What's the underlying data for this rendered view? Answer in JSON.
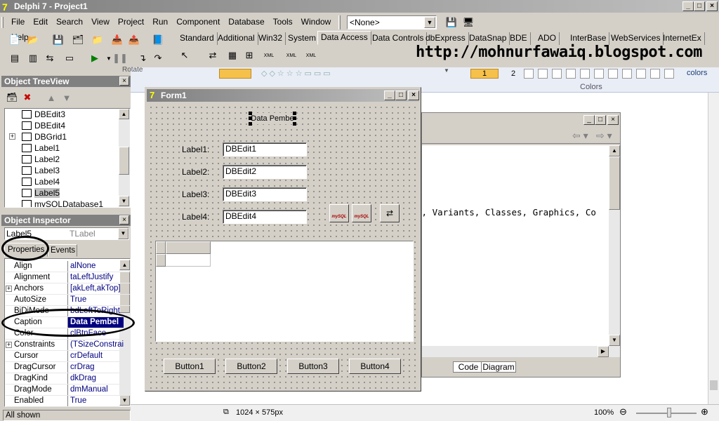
{
  "window": {
    "title": "Delphi 7 - Project1"
  },
  "menu": [
    "File",
    "Edit",
    "Search",
    "View",
    "Project",
    "Run",
    "Component",
    "Database",
    "Tools",
    "Window",
    "Help"
  ],
  "desktop_combo": {
    "value": "<None>"
  },
  "palette": {
    "tabs": [
      "Standard",
      "Additional",
      "Win32",
      "System",
      "Data Access",
      "Data Controls",
      "dbExpress",
      "DataSnap",
      "BDE",
      "ADO",
      "InterBase",
      "WebServices",
      "InternetEx"
    ],
    "active_tab": "Data Access"
  },
  "watermark": "http://mohnurfawaiq.blogspot.com",
  "background_app": {
    "rotate": "Rotate",
    "colors_label": "Colors",
    "colors_small": "colors",
    "color_1": "1",
    "color_2": "2",
    "editor_code_text": "s, Variants, Classes, Graphics, Co",
    "tab_code": "Code",
    "tab_diagram": "Diagram",
    "dimensions": "1024 × 575px",
    "zoom": "100%"
  },
  "treeview": {
    "title": "Object TreeView",
    "items": [
      {
        "label": "DBEdit3"
      },
      {
        "label": "DBEdit4"
      },
      {
        "label": "DBGrid1"
      },
      {
        "label": "Label1"
      },
      {
        "label": "Label2"
      },
      {
        "label": "Label3"
      },
      {
        "label": "Label4"
      },
      {
        "label": "Label5"
      },
      {
        "label": "mySQLDatabase1"
      }
    ],
    "selected": "Label5"
  },
  "inspector": {
    "title": "Object Inspector",
    "object_name": "Label5",
    "object_type": "TLabel",
    "tab_properties": "Properties",
    "tab_events": "Events",
    "rows": [
      {
        "name": "Align",
        "value": "alNone"
      },
      {
        "name": "Alignment",
        "value": "taLeftJustify"
      },
      {
        "name": "Anchors",
        "value": "[akLeft,akTop]"
      },
      {
        "name": "AutoSize",
        "value": "True"
      },
      {
        "name": "BiDiMode",
        "value": "bdLeftToRight"
      },
      {
        "name": "Caption",
        "value": "Data Pembel"
      },
      {
        "name": "Color",
        "value": "clBtnFace"
      },
      {
        "name": "Constraints",
        "value": "(TSizeConstraint"
      },
      {
        "name": "Cursor",
        "value": "crDefault"
      },
      {
        "name": "DragCursor",
        "value": "crDrag"
      },
      {
        "name": "DragKind",
        "value": "dkDrag"
      },
      {
        "name": "DragMode",
        "value": "dmManual"
      },
      {
        "name": "Enabled",
        "value": "True"
      }
    ],
    "status": "All shown"
  },
  "form": {
    "title": "Form1",
    "heading": "Data Pembe",
    "labels": [
      "Label1:",
      "Label2:",
      "Label3:",
      "Label4:"
    ],
    "edits": [
      "DBEdit1",
      "DBEdit2",
      "DBEdit3",
      "DBEdit4"
    ],
    "buttons": [
      "Button1",
      "Button2",
      "Button3",
      "Button4"
    ],
    "component_caption": "mySQL"
  }
}
